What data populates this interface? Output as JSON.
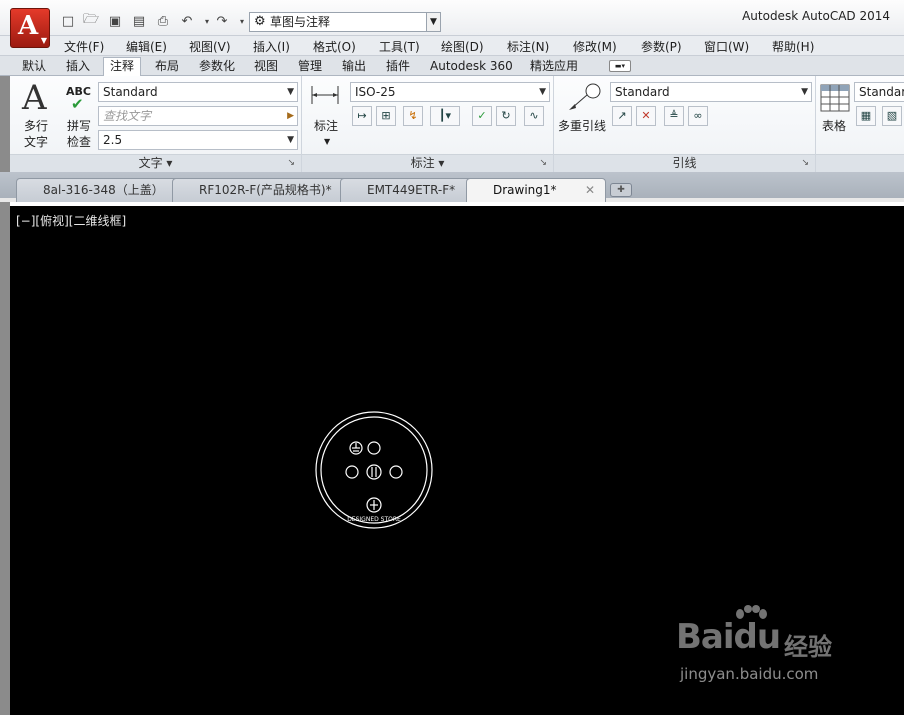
{
  "title_bar": {
    "app_title": "Autodesk AutoCAD 2014",
    "workspace": "草图与注释",
    "qat_icons": [
      "new-icon",
      "open-icon",
      "save-icon",
      "save-as-icon",
      "print-icon",
      "undo-icon",
      "redo-icon"
    ]
  },
  "menu": [
    "文件(F)",
    "编辑(E)",
    "视图(V)",
    "插入(I)",
    "格式(O)",
    "工具(T)",
    "绘图(D)",
    "标注(N)",
    "修改(M)",
    "参数(P)",
    "窗口(W)",
    "帮助(H)"
  ],
  "ribbon_tabs": [
    "默认",
    "插入",
    "注释",
    "布局",
    "参数化",
    "视图",
    "管理",
    "输出",
    "插件",
    "Autodesk 360",
    "精选应用"
  ],
  "active_ribbon_tab": "注释",
  "text_panel": {
    "title": "文字",
    "multiline_label_1": "多行",
    "multiline_label_2": "文字",
    "spell_label_1": "拼写",
    "spell_label_2": "检查",
    "abc_label": "ABC",
    "style": "Standard",
    "find_placeholder": "查找文字",
    "height": "2.5"
  },
  "dim_panel": {
    "title": "标注",
    "button_label": "标注",
    "style": "ISO-25"
  },
  "leader_panel": {
    "title": "引线",
    "button_label": "多重引线",
    "style": "Standard"
  },
  "table_panel": {
    "button_label": "表格",
    "style": "Standar"
  },
  "doc_tabs": [
    {
      "label": "8al-316-348（上盖）",
      "active": false
    },
    {
      "label": "RF102R-F(产品规格书)*",
      "active": false
    },
    {
      "label": "EMT449ETR-F*",
      "active": false
    },
    {
      "label": "Drawing1*",
      "active": true
    }
  ],
  "viewport_label": "[−][俯视][二维线框]",
  "drawing_text": "DESIGNED STORE",
  "watermark": {
    "brand": "Bai",
    "brand_tail": "du",
    "cn": "经验",
    "url": "jingyan.baidu.com"
  },
  "colors": {
    "canvas_bg": "#000000",
    "accent_red": "#c8281b",
    "ribbon_bg": "#f4f6f8"
  }
}
